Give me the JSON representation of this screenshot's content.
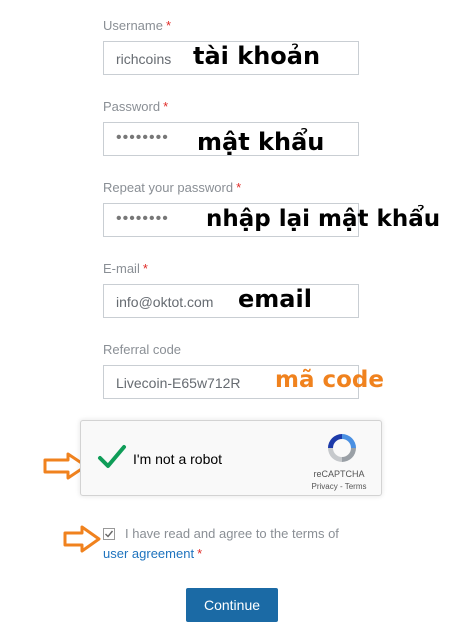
{
  "form": {
    "username": {
      "label": "Username",
      "value": "richcoins",
      "annotation": "tài khoản"
    },
    "password": {
      "label": "Password",
      "value": "••••••••",
      "annotation": "mật khẩu"
    },
    "repeat_password": {
      "label": "Repeat your password",
      "value": "••••••••",
      "annotation": "nhập lại mật khẩu"
    },
    "email": {
      "label": "E-mail",
      "value": "info@oktot.com",
      "annotation": "email"
    },
    "referral": {
      "label": "Referral code",
      "value": "Livecoin-E65w712R",
      "annotation": "mã code"
    },
    "required_mark": "*"
  },
  "captcha": {
    "text": "I'm not a robot",
    "brand": "reCAPTCHA",
    "links": "Privacy - Terms",
    "checked": true
  },
  "agreement": {
    "text": "I have read and agree to the terms of",
    "link": "user agreement",
    "required_mark": "*"
  },
  "continue_label": "Continue",
  "colors": {
    "required": "#e02b27",
    "annotation_orange": "#f0821e",
    "button": "#1b6aa5",
    "link": "#1e73be",
    "check_green": "#0f9d58"
  },
  "icons": [
    "checkmark-icon",
    "recaptcha-logo-icon",
    "arrow-right-icon"
  ]
}
